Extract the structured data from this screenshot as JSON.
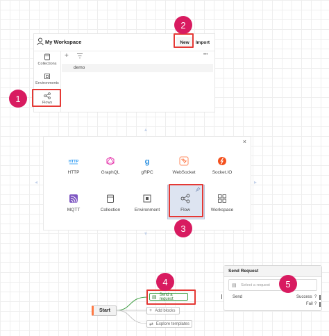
{
  "workspace": {
    "title": "My Workspace",
    "new_label": "New",
    "import_label": "Import",
    "sidebar": [
      {
        "label": "Collections",
        "icon": "collections-icon"
      },
      {
        "label": "Environments",
        "icon": "environments-icon"
      },
      {
        "label": "Flows",
        "icon": "flows-icon"
      }
    ],
    "toolbar": {
      "add": "+",
      "filter": "filter-icon",
      "more": "•••"
    },
    "items": [
      {
        "label": "demo"
      }
    ]
  },
  "new_dialog": {
    "close": "×",
    "tiles": [
      {
        "label": "HTTP",
        "icon": "http-icon",
        "color": "#2196f3"
      },
      {
        "label": "GraphQL",
        "icon": "graphql-icon",
        "color": "#e535ab"
      },
      {
        "label": "gRPC",
        "icon": "grpc-icon",
        "color": "#2a8fe0"
      },
      {
        "label": "WebSocket",
        "icon": "websocket-icon",
        "color": "#ff6b35"
      },
      {
        "label": "Socket.IO",
        "icon": "socketio-icon",
        "color": "#f4511e"
      },
      {
        "label": "MQTT",
        "icon": "mqtt-icon",
        "color": "#7e57c2"
      },
      {
        "label": "Collection",
        "icon": "collection-icon",
        "color": "#555555"
      },
      {
        "label": "Environment",
        "icon": "environment-icon",
        "color": "#555555"
      },
      {
        "label": "Flow",
        "icon": "flow-icon",
        "color": "#555555"
      },
      {
        "label": "Workspace",
        "icon": "workspace-icon",
        "color": "#555555"
      }
    ]
  },
  "flow": {
    "start_label": "Start",
    "options": [
      {
        "label": "Send a request",
        "icon": "request-icon"
      },
      {
        "label": "Add blocks",
        "icon": "add-icon"
      },
      {
        "label": "Explore templates",
        "icon": "templates-icon"
      }
    ]
  },
  "send_request_node": {
    "title": "Send Request",
    "select_placeholder": "Select a request",
    "send_label": "Send",
    "success_label": "Success",
    "fail_label": "Fail",
    "help": "?"
  },
  "callouts": [
    "1",
    "2",
    "3",
    "4",
    "5"
  ],
  "colors": {
    "callout": "#d81b60",
    "highlight": "#e53935",
    "accent": "#ff7a45",
    "request_chip": "#43a047"
  }
}
